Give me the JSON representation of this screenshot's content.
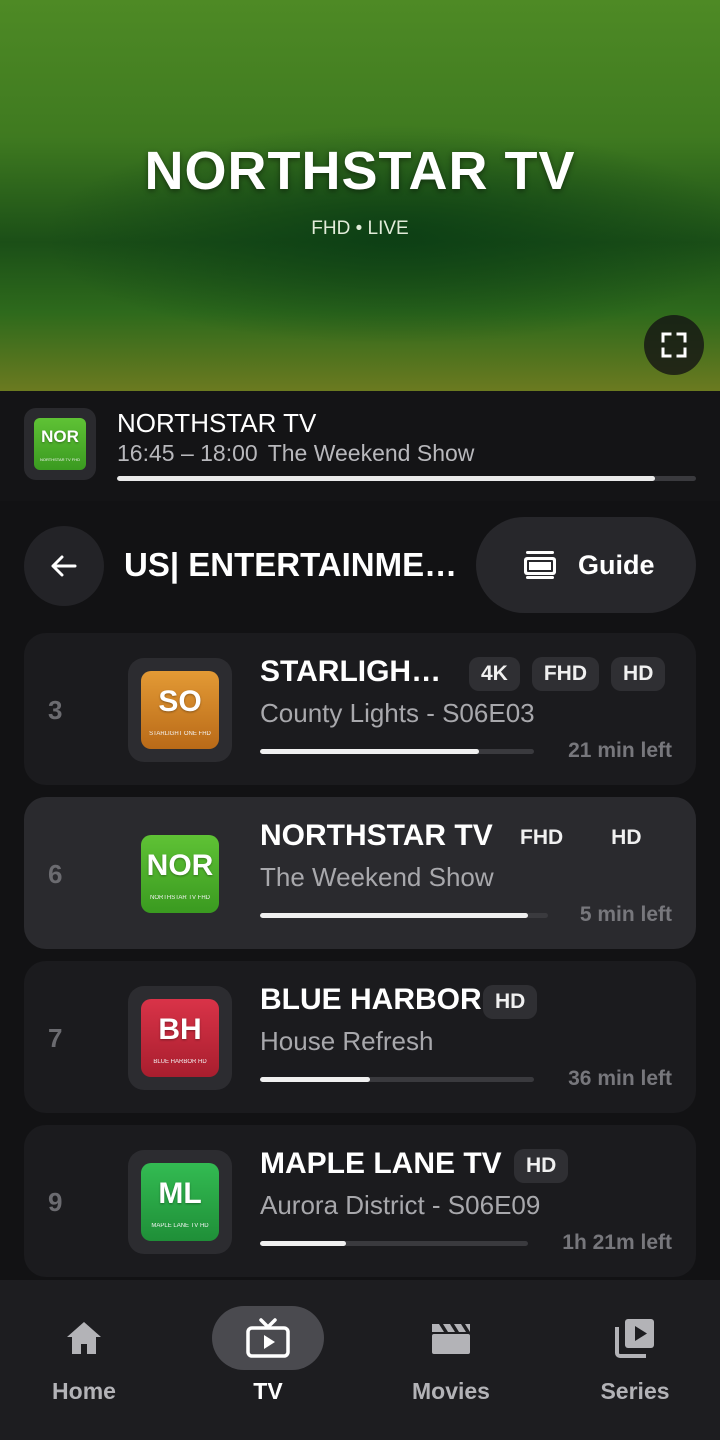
{
  "player": {
    "channel_title": "NORTHSTAR TV",
    "subtitle": "FHD • LIVE",
    "fullscreen_icon": "fullscreen-icon"
  },
  "now_playing": {
    "logo_abbr": "NOR",
    "logo_caption": "NORTHSTAR TV FHD",
    "logo_color": "#4caf2a",
    "title": "NORTHSTAR TV",
    "time_range": "16:45 – 18:00",
    "program": "The Weekend Show",
    "progress_percent": 93
  },
  "category": {
    "back_icon": "arrow-left-icon",
    "title": "US| ENTERTAINMENT",
    "guide_label": "Guide",
    "guide_icon": "guide-icon"
  },
  "channels": [
    {
      "number": "3",
      "logo_abbr": "SO",
      "logo_caption": "STARLIGHT ONE FHD",
      "logo_color": "#d98a2b",
      "name": "STARLIGHT ONE",
      "badges": [
        "4K",
        "FHD",
        "HD"
      ],
      "program": "County Lights - S06E03",
      "progress_percent": 80,
      "time_left": "21 min left",
      "active": false
    },
    {
      "number": "6",
      "logo_abbr": "NOR",
      "logo_caption": "NORTHSTAR TV FHD",
      "logo_color": "#4caf2a",
      "name": "NORTHSTAR TV",
      "badges": [
        "FHD",
        "HD"
      ],
      "program": "The Weekend Show",
      "progress_percent": 93,
      "time_left": "5 min left",
      "active": true
    },
    {
      "number": "7",
      "logo_abbr": "BH",
      "logo_caption": "BLUE HARBOR HD",
      "logo_color": "#c8283a",
      "name": "BLUE HARBOR",
      "badges": [
        "HD"
      ],
      "program": "House Refresh",
      "progress_percent": 40,
      "time_left": "36 min left",
      "active": false
    },
    {
      "number": "9",
      "logo_abbr": "ML",
      "logo_caption": "MAPLE LANE TV HD",
      "logo_color": "#27a844",
      "name": "MAPLE LANE TV",
      "badges": [
        "HD"
      ],
      "program": "Aurora District - S06E09",
      "progress_percent": 32,
      "time_left": "1h 21m left",
      "active": false
    }
  ],
  "bottom_nav": [
    {
      "label": "Home",
      "icon": "home-icon",
      "active": false
    },
    {
      "label": "TV",
      "icon": "tv-icon",
      "active": true
    },
    {
      "label": "Movies",
      "icon": "clapperboard-icon",
      "active": false
    },
    {
      "label": "Series",
      "icon": "series-icon",
      "active": false
    }
  ]
}
